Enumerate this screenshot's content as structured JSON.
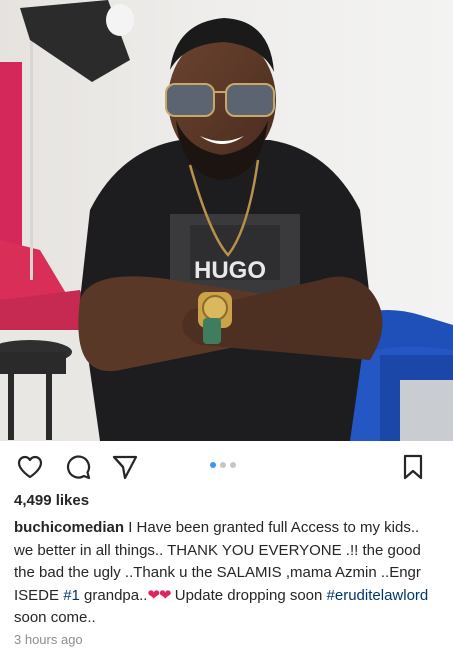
{
  "post": {
    "likes_label": "4,499 likes",
    "username": "buchicomedian",
    "caption_part1": " I Have been granted full Access to my kids.. we better in all things.. THANK YOU EVERYONE .!! the good the bad the ugly ..Thank u the SALAMIS ,mama Azmin ..Engr ISEDE ",
    "hashtag1": "#1",
    "caption_part2": " grandpa..",
    "hearts": "❤❤",
    "caption_part3": " Update dropping soon ",
    "hashtag2": "#eruditelawlord",
    "caption_part4": " soon come..",
    "timestamp": "3 hours ago",
    "shirt_text": "HUGO"
  },
  "carousel": {
    "count": 3,
    "active_index": 0
  },
  "icons": {
    "like": "heart-outline-icon",
    "comment": "comment-bubble-icon",
    "share": "paper-plane-icon",
    "save": "bookmark-icon"
  },
  "colors": {
    "text": "#262626",
    "muted": "#8e8e8e",
    "hashtag": "#00376b",
    "active_dot": "#3897f0",
    "inactive_dot": "#c7c7c7",
    "heart": "#e0245e"
  }
}
